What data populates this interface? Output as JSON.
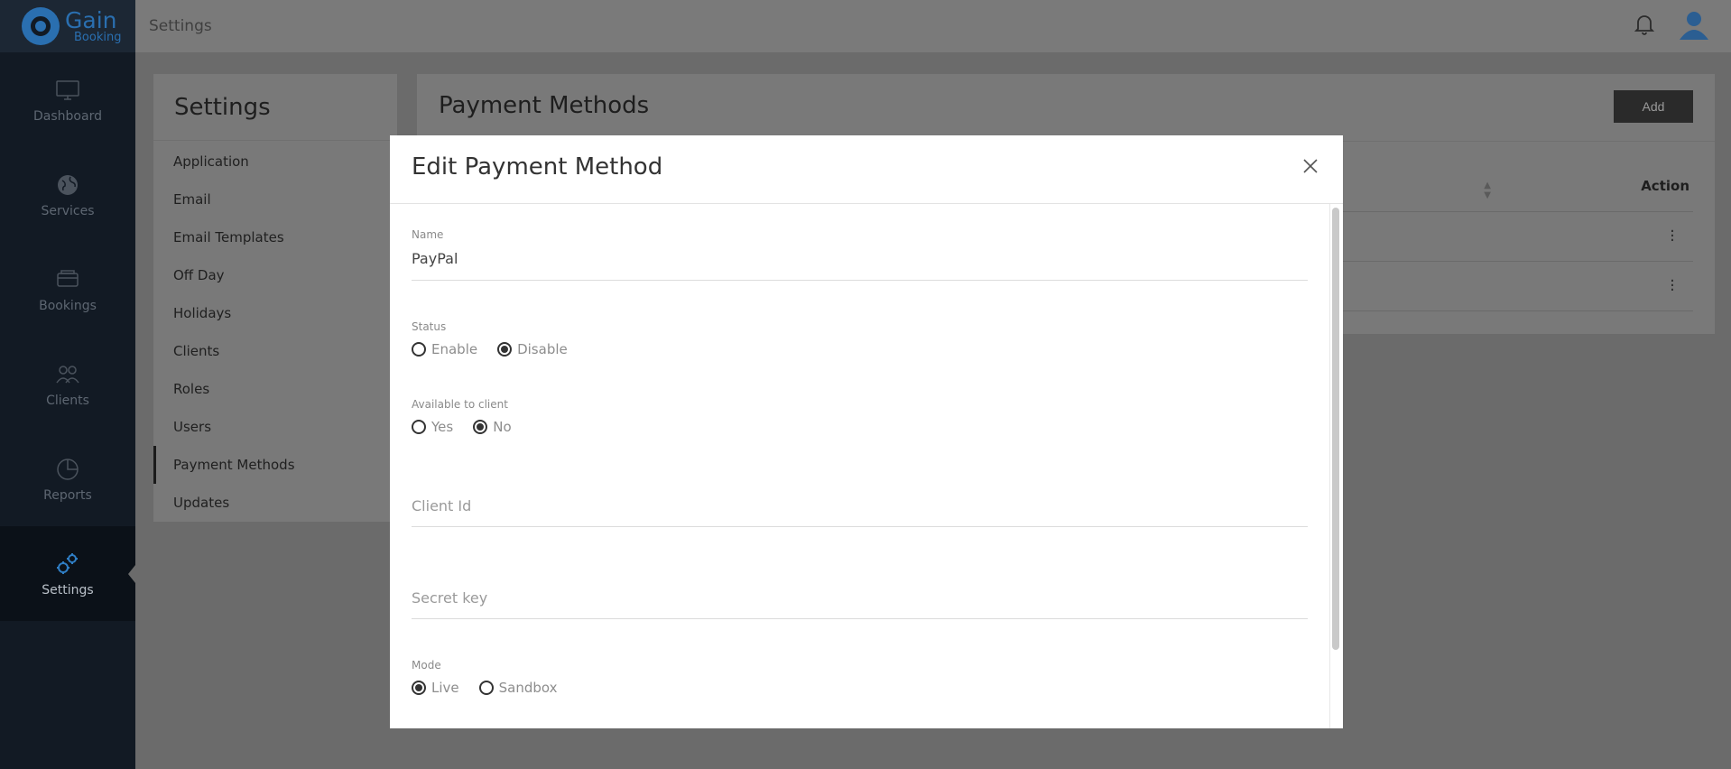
{
  "brand": {
    "name_top": "Gain",
    "name_bottom": "Booking",
    "color": "#2a6fb0"
  },
  "topbar": {
    "title": "Settings"
  },
  "sidebar": {
    "items": [
      {
        "label": "Dashboard",
        "icon": "monitor-icon"
      },
      {
        "label": "Services",
        "icon": "globe-icon"
      },
      {
        "label": "Bookings",
        "icon": "tray-icon"
      },
      {
        "label": "Clients",
        "icon": "users-icon"
      },
      {
        "label": "Reports",
        "icon": "pie-chart-icon"
      },
      {
        "label": "Settings",
        "icon": "gears-icon",
        "active": true
      }
    ]
  },
  "settings_menu": {
    "title": "Settings",
    "items": [
      "Application",
      "Email",
      "Email Templates",
      "Off Day",
      "Holidays",
      "Clients",
      "Roles",
      "Users",
      "Payment Methods",
      "Updates"
    ],
    "active": "Payment Methods"
  },
  "payment_methods": {
    "title": "Payment Methods",
    "add_label": "Add",
    "action_header": "Action"
  },
  "modal": {
    "title": "Edit Payment Method",
    "name": {
      "label": "Name",
      "value": "PayPal"
    },
    "status": {
      "label": "Status",
      "options": [
        "Enable",
        "Disable"
      ],
      "selected": "Disable"
    },
    "available": {
      "label": "Available to client",
      "options": [
        "Yes",
        "No"
      ],
      "selected": "No"
    },
    "client_id": {
      "placeholder": "Client Id"
    },
    "secret_key": {
      "placeholder": "Secret key"
    },
    "mode": {
      "label": "Mode",
      "options": [
        "Live",
        "Sandbox"
      ],
      "selected": "Live"
    }
  }
}
